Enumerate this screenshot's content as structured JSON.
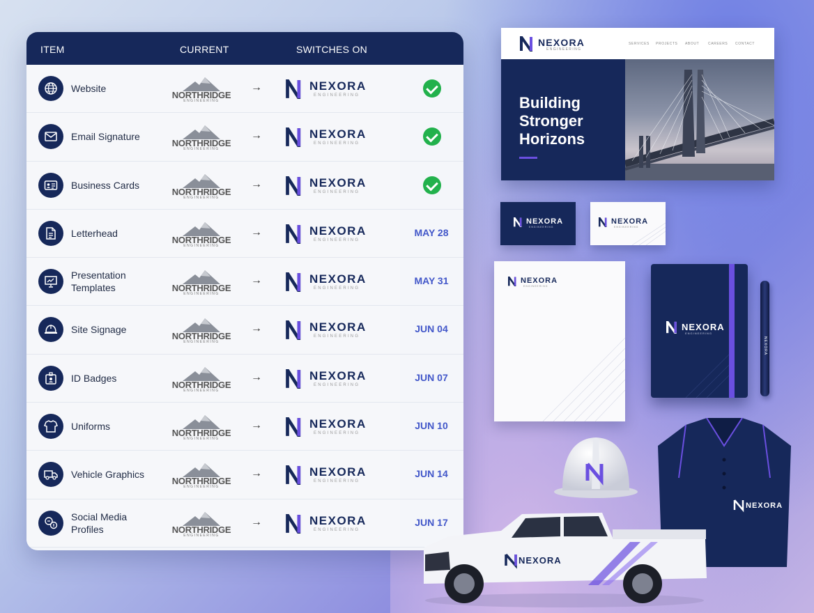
{
  "table": {
    "headers": {
      "item": "ITEM",
      "current": "CURRENT",
      "switches_on": "SWITCHES ON"
    },
    "old_brand": {
      "name": "NORTHRIDGE",
      "sub": "ENGINEERING"
    },
    "new_brand": {
      "name": "NEXORA",
      "sub": "ENGINEERING"
    },
    "arrow": "→",
    "rows": [
      {
        "label": "Website",
        "icon": "globe-icon",
        "status": "done"
      },
      {
        "label": "Email Signature",
        "icon": "envelope-icon",
        "status": "done"
      },
      {
        "label": "Business Cards",
        "icon": "id-card-icon",
        "status": "done"
      },
      {
        "label": "Letterhead",
        "icon": "document-icon",
        "status": "MAY 28"
      },
      {
        "label": "Presentation\nTemplates",
        "icon": "presentation-icon",
        "status": "MAY 31"
      },
      {
        "label": "Site Signage",
        "icon": "hard-hat-icon",
        "status": "JUN 04"
      },
      {
        "label": "ID Badges",
        "icon": "badge-icon",
        "status": "JUN 07"
      },
      {
        "label": "Uniforms",
        "icon": "shirt-icon",
        "status": "JUN 10"
      },
      {
        "label": "Vehicle Graphics",
        "icon": "truck-icon",
        "status": "JUN 14"
      },
      {
        "label": "Social Media\nProfiles",
        "icon": "social-icon",
        "status": "JUN 17"
      }
    ]
  },
  "mockups": {
    "website": {
      "logo": "NEXORA",
      "logo_sub": "ENGINEERING",
      "nav": [
        "SERVICES",
        "PROJECTS",
        "ABOUT",
        "CAREERS",
        "CONTACT"
      ],
      "headline": "Building\nStronger\nHorizons"
    },
    "brand_name": "NEXORA",
    "brand_sub": "ENGINEERING"
  },
  "colors": {
    "navy": "#16285a",
    "accent": "#6a4fe0",
    "check": "#22b14c",
    "date": "#4257c9"
  }
}
